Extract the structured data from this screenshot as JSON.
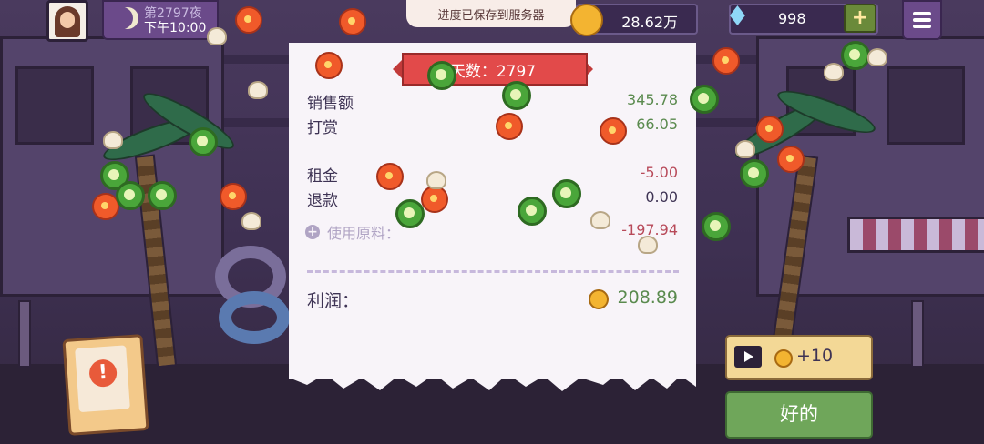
{
  "header": {
    "day_label": "第2797夜",
    "time_label": "下午10:00",
    "toast": "进度已保存到服务器",
    "coins": "28.62万",
    "gems": "998",
    "gem_add": "+"
  },
  "receipt": {
    "banner": "天数：2797",
    "rows": [
      {
        "label": "销售额",
        "value": "345.78"
      },
      {
        "label": "打赏",
        "value": "66.05"
      },
      {
        "label": "租金",
        "value": "-5.00"
      },
      {
        "label": "退款",
        "value": "0.00"
      }
    ],
    "materials_label": "使用原料：",
    "materials_value": "-197.94",
    "profit_label": "利润：",
    "profit_value": "208.89"
  },
  "buttons": {
    "ad_reward": "+10",
    "ok": "好的",
    "alert_symbol": "!"
  },
  "colors": {
    "positive": "#5a8a4e",
    "negative": "#b84a5a",
    "ok_button": "#6fa65a",
    "banner": "#e24a4a"
  },
  "icons": [
    "moon-icon",
    "coin-icon",
    "diamond-icon",
    "plus-icon",
    "menu-icon",
    "play-icon",
    "alert-icon"
  ]
}
